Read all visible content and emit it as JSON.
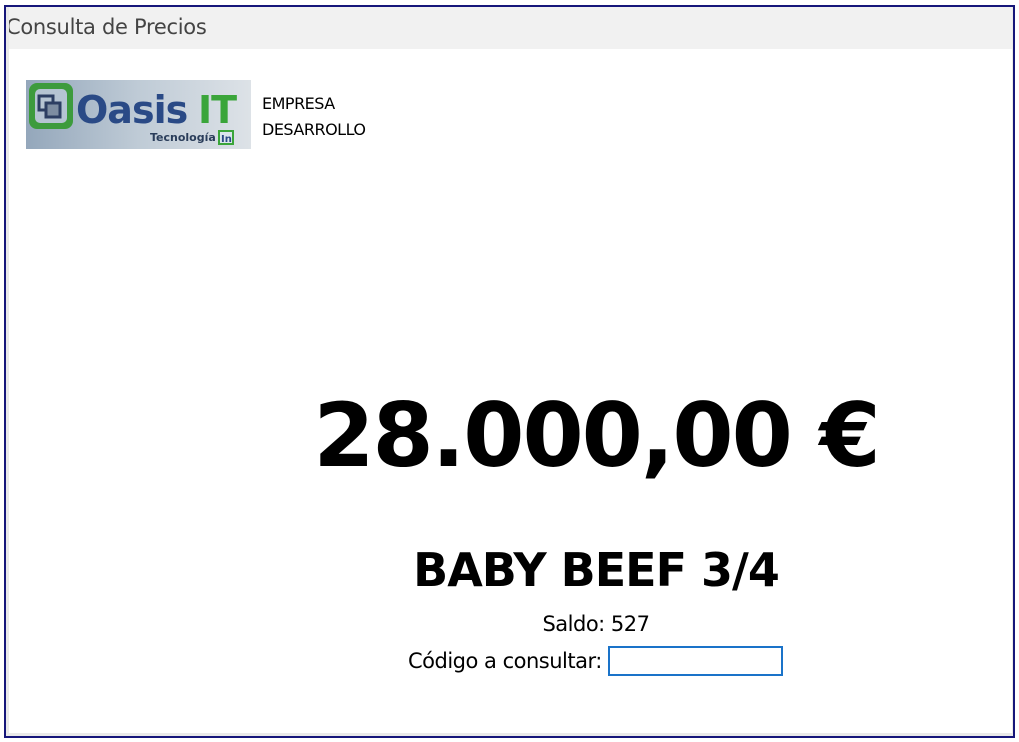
{
  "window": {
    "title": "Consulta de Precios"
  },
  "logo": {
    "brand": "OasisIT",
    "tagline": "Tecnología",
    "badge": "In",
    "colors": {
      "accent": "#3aa53a",
      "text": "#2a4d8f"
    }
  },
  "company": {
    "line1": "EMPRESA",
    "line2": "DESARROLLO"
  },
  "price": {
    "display": "28.000,00 €"
  },
  "product": {
    "name": "BABY BEEF 3/4"
  },
  "saldo": {
    "text": "Saldo: 527"
  },
  "code": {
    "label": "Código a consultar:",
    "value": "",
    "placeholder": ""
  },
  "colors": {
    "frame": "#16167a",
    "input_border": "#1a73c9"
  }
}
